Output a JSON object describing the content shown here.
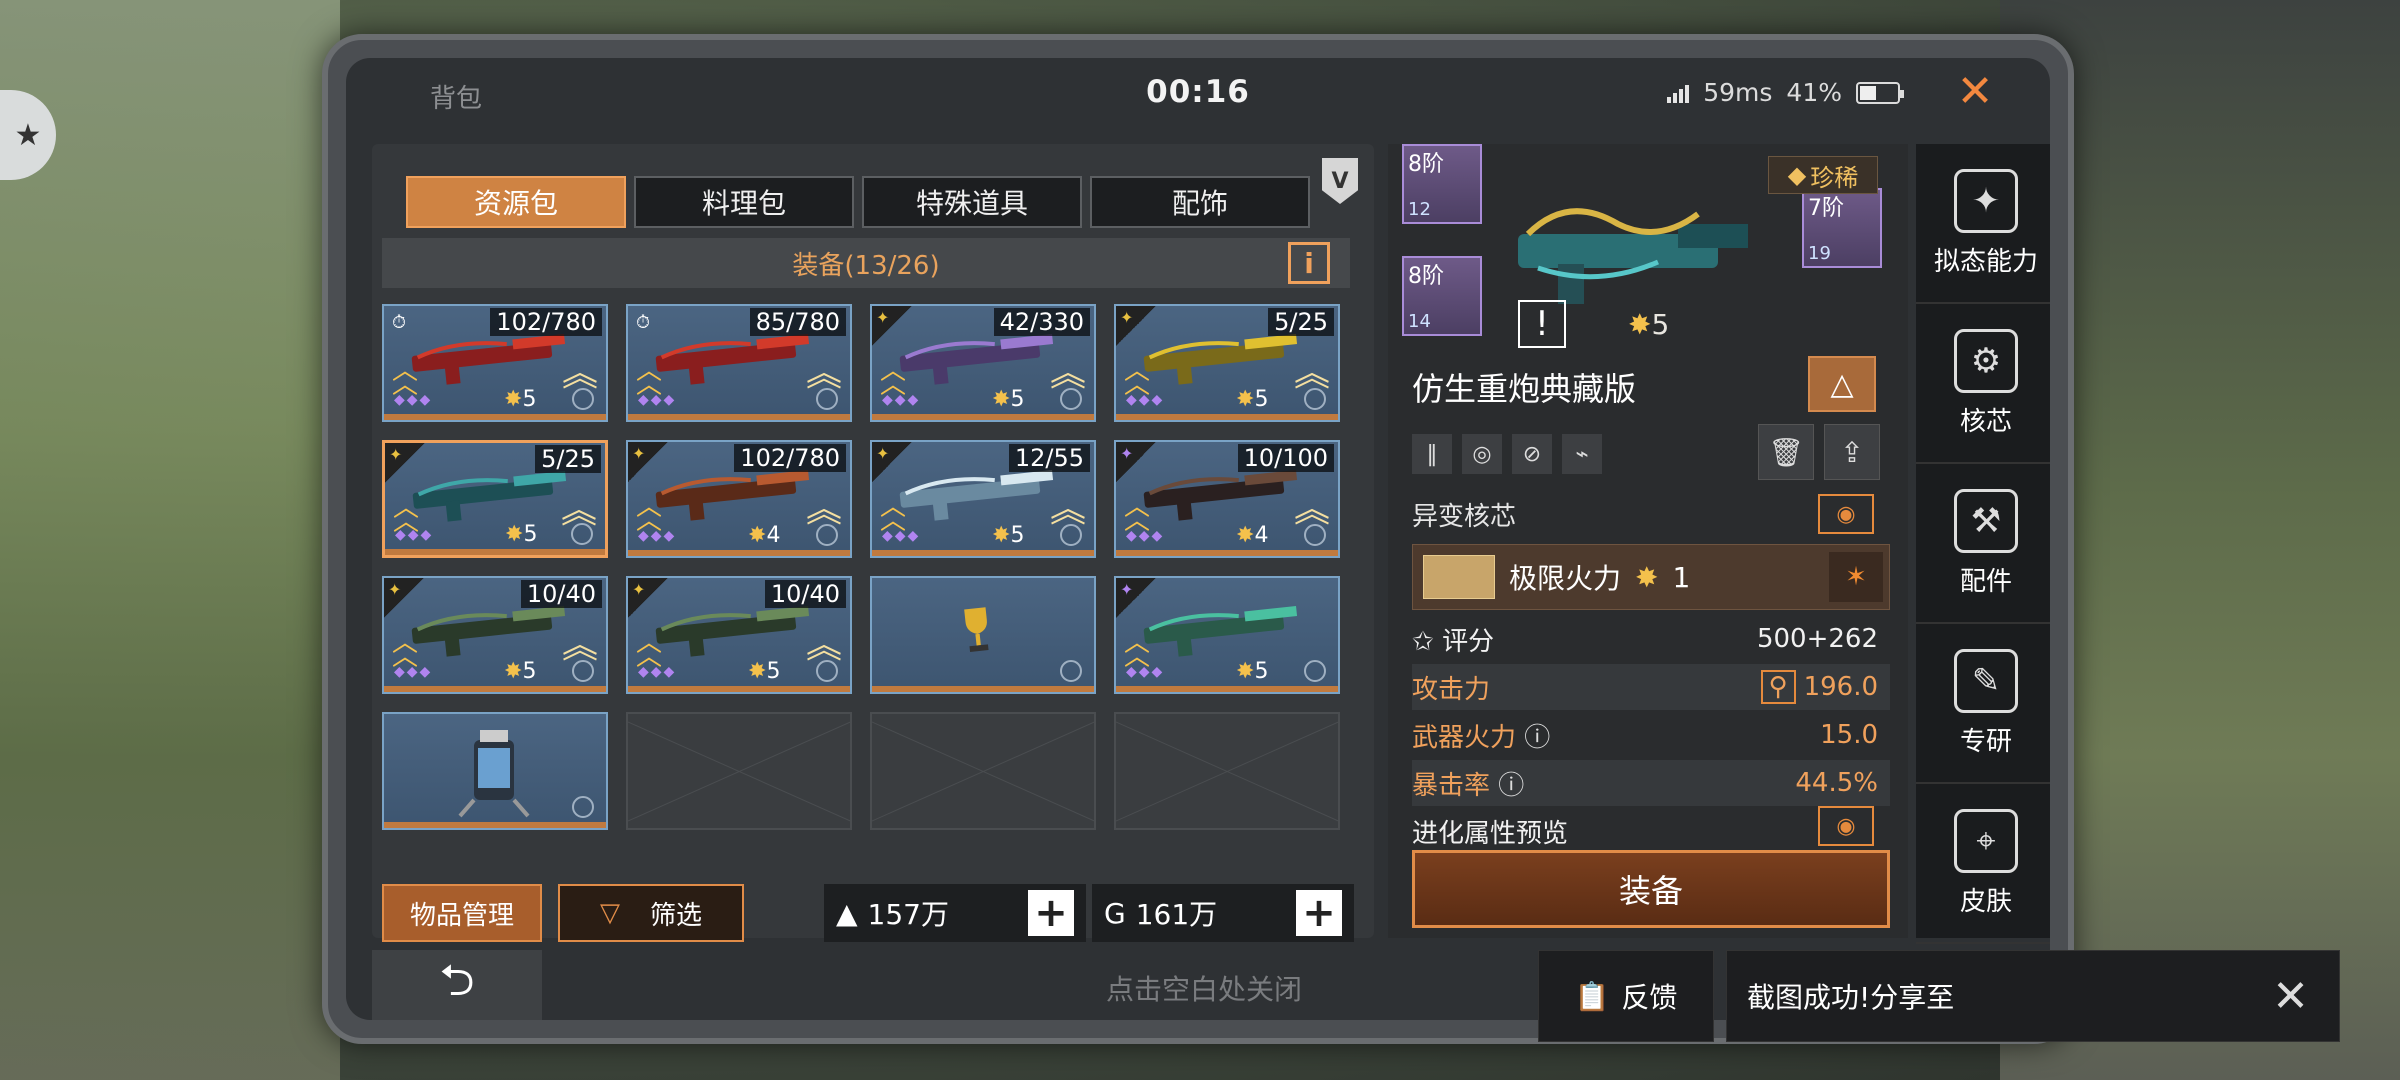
{
  "header": {
    "title": "背包",
    "time": "00:16",
    "ping": "59ms",
    "battery": "41%"
  },
  "tabs": [
    {
      "label": "资源包",
      "active": true
    },
    {
      "label": "料理包",
      "active": false
    },
    {
      "label": "特殊道具",
      "active": false
    },
    {
      "label": "配饰",
      "active": false
    }
  ],
  "vip_badge": "V",
  "equip_bar": {
    "label": "装备(13/26)",
    "info": "i"
  },
  "items": [
    {
      "count": "102/780",
      "stars": "5",
      "timer": true,
      "color": "red"
    },
    {
      "count": "85/780",
      "stars": "",
      "timer": true,
      "color": "red"
    },
    {
      "count": "42/330",
      "stars": "5",
      "color": "purple"
    },
    {
      "count": "5/25",
      "stars": "5",
      "color": "gold"
    },
    {
      "count": "5/25",
      "stars": "5",
      "color": "teal",
      "selected": true
    },
    {
      "count": "102/780",
      "stars": "4",
      "color": "rust"
    },
    {
      "count": "12/55",
      "stars": "5",
      "color": "cyan"
    },
    {
      "count": "10/100",
      "stars": "4",
      "color": "dark"
    },
    {
      "count": "10/40",
      "stars": "5",
      "color": "sniper"
    },
    {
      "count": "10/40",
      "stars": "5",
      "color": "sniper"
    },
    {
      "count": "",
      "stars": "",
      "color": "trophy"
    },
    {
      "count": "",
      "stars": "5",
      "color": "blade"
    },
    {
      "count": "",
      "stars": "",
      "color": "canister"
    }
  ],
  "buttons": {
    "manage": "物品管理",
    "filter": "筛选"
  },
  "currency": [
    {
      "icon": "gold-icon",
      "value": "157万"
    },
    {
      "icon": "g-coin-icon",
      "value": "161万"
    }
  ],
  "footer": {
    "tap_close": "点击空白处关闭"
  },
  "detail": {
    "mods": [
      {
        "level": "8阶",
        "num": "12"
      },
      {
        "level": "8阶",
        "num": "14"
      },
      {
        "level": "7阶",
        "num": "19"
      }
    ],
    "rarity": "珍稀",
    "stars": "5",
    "name": "仿生重炮典藏版",
    "core_title": "异变核芯",
    "core": {
      "name": "极限火力",
      "level": "1"
    },
    "score": {
      "label": "评分",
      "value": "500+262"
    },
    "stats": [
      {
        "label": "攻击力",
        "value": "196.0"
      },
      {
        "label": "武器火力",
        "value": "15.0"
      },
      {
        "label": "暴击率",
        "value": "44.5%"
      }
    ],
    "evo_preview": "进化属性预览",
    "equip_label": "装备"
  },
  "sidebar": [
    "拟态能力",
    "核芯",
    "配件",
    "专研",
    "皮肤"
  ],
  "overlay": {
    "feedback": "反馈",
    "toast": "截图成功!分享至"
  }
}
